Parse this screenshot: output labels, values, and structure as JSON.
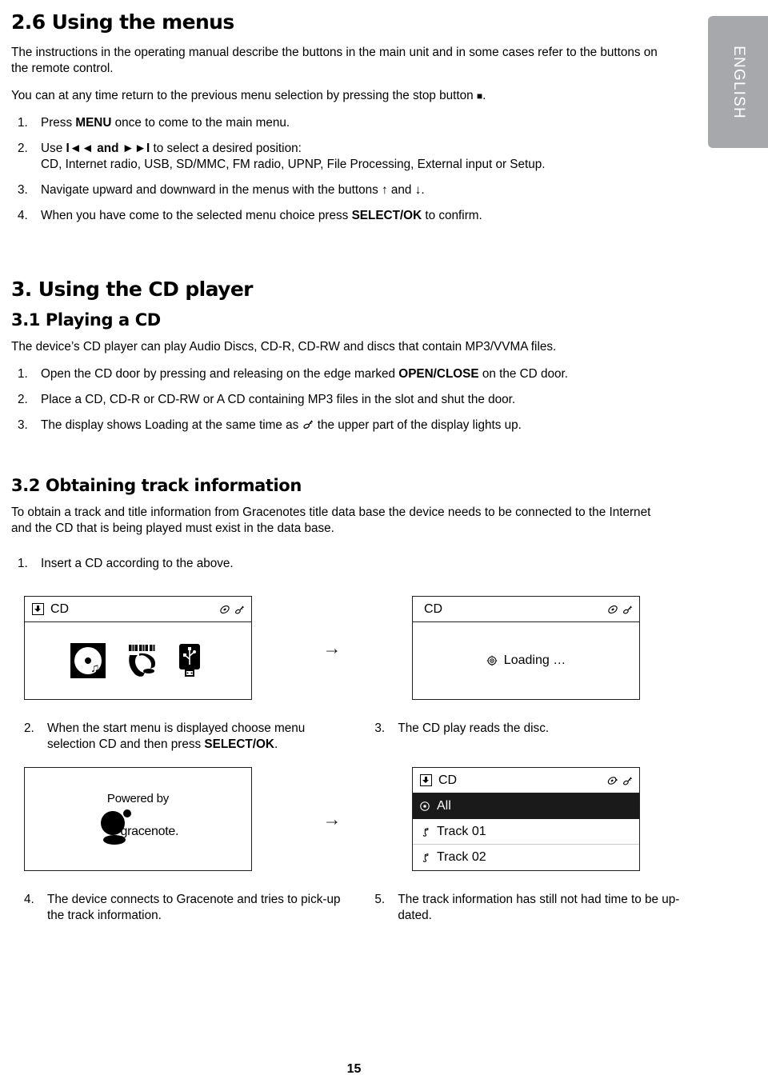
{
  "language_tab": {
    "label": "ENGLISH"
  },
  "section_2_6": {
    "heading": "2.6 Using the menus",
    "intro": "The instructions in the operating manual describe the buttons in the main unit and in some cases refer to the buttons on the remote control.",
    "stop_note_prefix": "You can at any time return to the previous menu selection by pressing the stop button ",
    "stop_note_icon": "■",
    "stop_note_suffix": ".",
    "steps": [
      {
        "num": "1.",
        "pre": "Press ",
        "bold": "MENU",
        "post": " once to come to the main menu."
      },
      {
        "num": "2.",
        "pre": "Use ",
        "bold": "I◄◄ and ►►I",
        "post": " to select a desired position:",
        "line2": "CD, Internet radio, USB, SD/MMC, FM radio, UPNP, File Processing, External input or Setup."
      },
      {
        "num": "3.",
        "pre": "Navigate upward and downward in the menus with the buttons ↑ and ↓.",
        "bold": "",
        "post": ""
      },
      {
        "num": "4.",
        "pre": "When you have come to the selected menu choice press ",
        "bold": "SELECT/OK",
        "post": " to confirm."
      }
    ]
  },
  "section_3": {
    "heading": "3. Using the CD player",
    "sub_3_1": {
      "heading": "3.1 Playing a CD",
      "intro": "The device’s CD player can play Audio Discs, CD-R, CD-RW and discs that contain MP3/VVMA files.",
      "steps": [
        {
          "num": "1.",
          "pre": "Open the CD door by pressing and releasing on the edge marked ",
          "bold": "OPEN/CLOSE",
          "post": " on the CD door."
        },
        {
          "num": "2.",
          "pre": "Place a CD, CD-R or CD-RW or A CD containing MP3 files in the slot and shut the door.",
          "bold": "",
          "post": ""
        },
        {
          "num": "3.",
          "pre": "The display shows Loading at the same time as ",
          "bold": "",
          "post": " the upper part of the display lights up.",
          "inline_icon": "disc-read-icon"
        }
      ]
    },
    "sub_3_2": {
      "heading": "3.2 Obtaining track information",
      "intro": "To obtain a track and title information from Gracenotes title data base the device needs to be connected to the Internet and the CD that is being played must exist in the data base.",
      "step_1": {
        "num": "1.",
        "text": "Insert a CD according to the above."
      }
    }
  },
  "display_row_1": {
    "panel_left": {
      "header_title": "CD",
      "header_left_icon": "download-box-icon",
      "header_right_icons": [
        "disc-icon",
        "network-icon"
      ],
      "body_icons": [
        "cd-music-icon",
        "internet-radio-www-icon",
        "usb-stick-icon"
      ]
    },
    "arrow": "→",
    "panel_right": {
      "header_title": "CD",
      "header_right_icons": [
        "disc-icon",
        "network-icon"
      ],
      "body_text": "Loading …",
      "body_icon": "gear-icon"
    }
  },
  "captions_row_1": [
    {
      "num": "2.",
      "pre": "When the start menu is displayed choose menu selection CD and then press ",
      "bold": "SELECT/OK",
      "post": "."
    },
    {
      "num": "3.",
      "pre": "The CD play reads the disc.",
      "bold": "",
      "post": ""
    }
  ],
  "display_row_2": {
    "panel_left": {
      "powered_by": "Powered by",
      "logo_text": "gracenote."
    },
    "arrow": "→",
    "panel_right": {
      "header_title": "CD",
      "header_left_icon": "download-box-icon",
      "header_right_icons": [
        "disc-refresh-icon",
        "network-icon"
      ],
      "rows": [
        {
          "label": "All",
          "icon": "disc-icon",
          "selected": true
        },
        {
          "label": "Track 01",
          "icon": "music-note-icon",
          "selected": false
        },
        {
          "label": "Track 02",
          "icon": "music-note-icon",
          "selected": false
        }
      ]
    }
  },
  "captions_row_2": [
    {
      "num": "4.",
      "pre": "The device connects to Gracenote and tries to pick-up the track information.",
      "bold": "",
      "post": ""
    },
    {
      "num": "5.",
      "pre": "The track information has still not had time to be up-dated.",
      "bold": "",
      "post": ""
    }
  ],
  "footer": {
    "page_number": "15"
  }
}
